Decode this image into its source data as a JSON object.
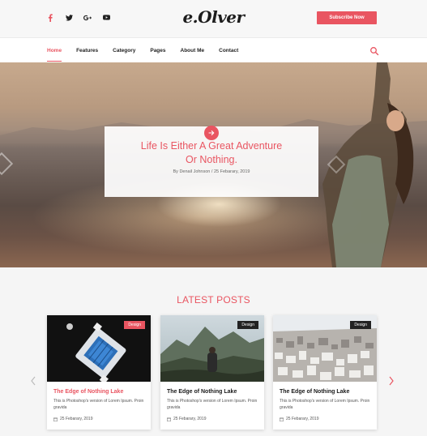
{
  "header": {
    "social_icons": [
      "facebook-icon",
      "twitter-icon",
      "google-plus-icon",
      "youtube-icon"
    ],
    "logo_text": "e.Olver",
    "subscribe_label": "Subscribe Now"
  },
  "nav": {
    "items": [
      {
        "label": "Home",
        "active": true
      },
      {
        "label": "Features",
        "active": false
      },
      {
        "label": "Category",
        "active": false
      },
      {
        "label": "Pages",
        "active": false
      },
      {
        "label": "About Me",
        "active": false
      },
      {
        "label": "Contact",
        "active": false
      }
    ],
    "search_icon": "search-icon"
  },
  "hero": {
    "title_line1": "Life Is Either A Great Adventure",
    "title_line2": "Or Nothing.",
    "meta": "By Denail Johnson / 25 Febarary, 2019"
  },
  "latest": {
    "title": "LATEST POSTS",
    "posts": [
      {
        "badge": "Design",
        "title": "The Edge of Nothing Lake",
        "excerpt": "This is Photoshop's version of Lorem Ipsum. Proin gravida",
        "date": "25 Febarary, 2019"
      },
      {
        "badge": "Design",
        "title": "The Edge of Nothing Lake",
        "excerpt": "This is Photoshop's version of Lorem Ipsum. Proin gravida",
        "date": "25 Febarary, 2019"
      },
      {
        "badge": "Design",
        "title": "The Edge of Nothing Lake",
        "excerpt": "This is Photoshop's version of Lorem Ipsum. Proin gravida",
        "date": "25 Febarary, 2019"
      }
    ]
  },
  "colors": {
    "accent": "#e95561",
    "dark_badge": "#222222"
  }
}
